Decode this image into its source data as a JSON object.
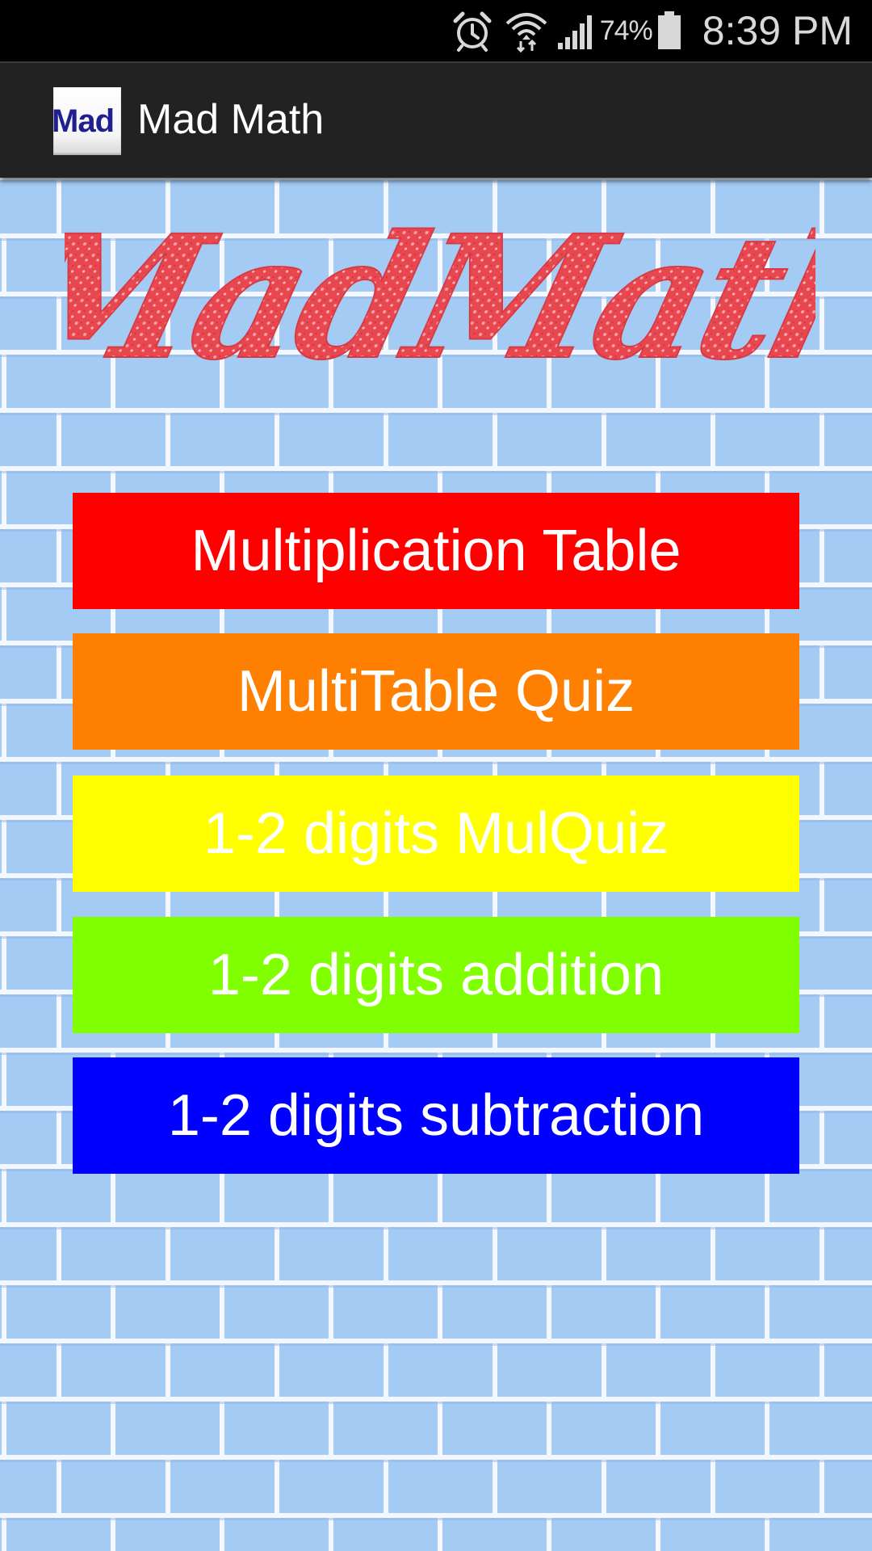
{
  "status_bar": {
    "battery_percent": "74%",
    "time": "8:39 PM",
    "icons": [
      "alarm-icon",
      "wifi-icon",
      "signal-icon",
      "battery-icon"
    ]
  },
  "action_bar": {
    "app_icon_text": "Mad",
    "title": "Mad Math"
  },
  "logo": {
    "text": "MadMath"
  },
  "menu": {
    "buttons": [
      {
        "label": "Multiplication Table",
        "color": "#ff0000"
      },
      {
        "label": "MultiTable Quiz",
        "color": "#ff7f00"
      },
      {
        "label": "1-2 digits MulQuiz",
        "color": "#ffff00"
      },
      {
        "label": "1-2 digits addition",
        "color": "#80ff00"
      },
      {
        "label": "1-2 digits subtraction",
        "color": "#0000ff"
      }
    ]
  },
  "colors": {
    "status_bar_bg": "#000000",
    "action_bar_bg": "#222222",
    "wall_bg": "#a4cbf4",
    "mortar": "#f4f8fe",
    "logo_red": "#e8474f"
  }
}
